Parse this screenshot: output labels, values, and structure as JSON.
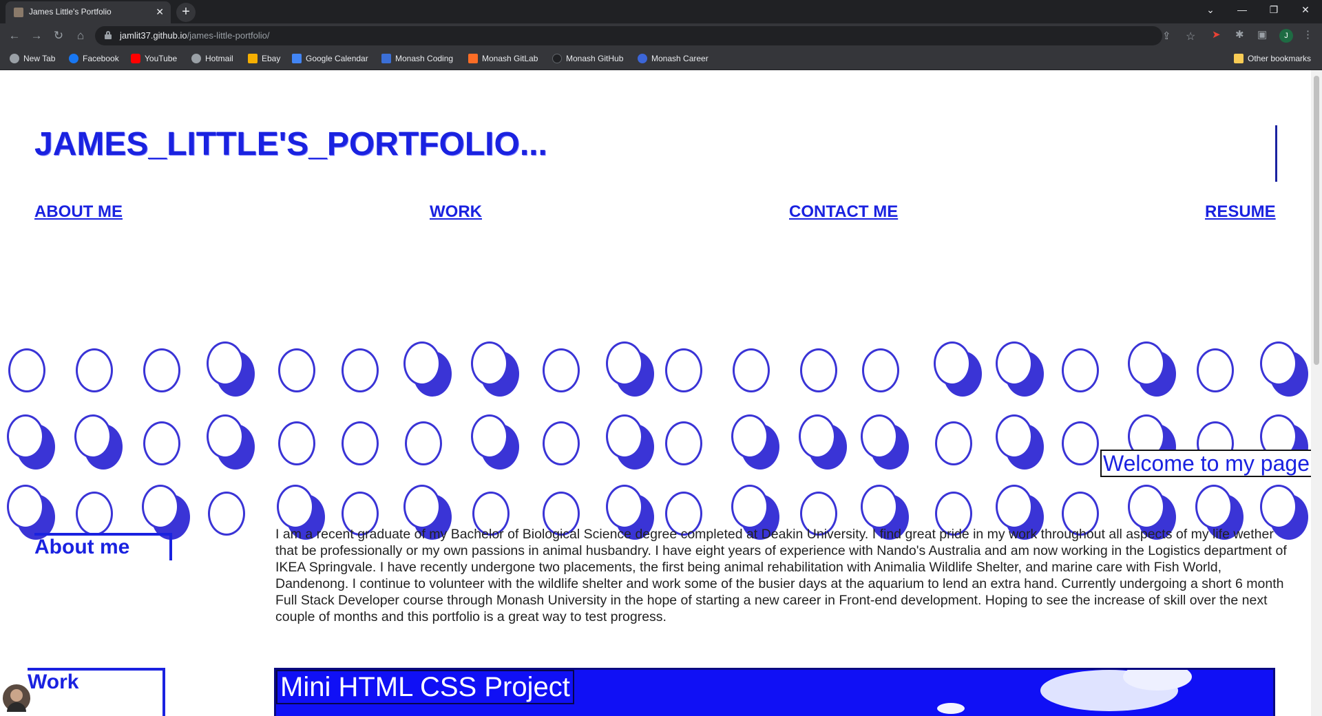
{
  "browser": {
    "tab_title": "James Little's Portfolio",
    "url_host": "jamlit37.github.io",
    "url_path": "/james-little-portfolio/",
    "profile_initial": "J",
    "bookmarks": [
      {
        "label": "New Tab",
        "icon": "globe-icon",
        "color": "#9aa0a6"
      },
      {
        "label": "Facebook",
        "icon": "facebook-icon",
        "color": "#1877f2"
      },
      {
        "label": "YouTube",
        "icon": "youtube-icon",
        "color": "#ff0000"
      },
      {
        "label": "Hotmail",
        "icon": "globe-icon",
        "color": "#9aa0a6"
      },
      {
        "label": "Ebay",
        "icon": "ebay-icon",
        "color": "#f5af02"
      },
      {
        "label": "Google Calendar",
        "icon": "calendar-icon",
        "color": "#4285f4"
      },
      {
        "label": "Monash Coding",
        "icon": "monash-icon",
        "color": "#3b6fd6"
      },
      {
        "label": "Monash  GitLab",
        "icon": "gitlab-icon",
        "color": "#fc6d26"
      },
      {
        "label": "Monash GitHub",
        "icon": "github-icon",
        "color": "#202124"
      },
      {
        "label": "Monash Career",
        "icon": "career-icon",
        "color": "#3c66d8"
      }
    ],
    "other_bookmarks": "Other bookmarks"
  },
  "site": {
    "title": "JAMES_LITTLE'S_PORTFOLIO...",
    "nav": [
      "ABOUT ME",
      "WORK",
      "CONTACT ME",
      "RESUME"
    ],
    "welcome": "Welcome to my page",
    "about_heading": "About me",
    "about_text": "I am a recent graduate of my Bachelor of Biological Science degree completed at Deakin University. I find great pride in my work throughout all aspects of my life wether that be professionally or my own passions in animal husbandry. I have eight years of experience with Nando's Australia and am now working in the Logistics department of IKEA Springvale. I have recently undergone two placements, the first being animal rehabilitation with Animalia Wildlife Shelter, and marine care with Fish World, Dandenong. I continue to volunteer with the wildlife shelter and work some of the busier days at the aquarium to lend an extra hand. Currently undergoing a short 6 month Full Stack Developer course through Monash University in the hope of starting a new career in Front-end development. Hoping to see the increase of skill over the next couple of months and this portfolio is a great way to test progress.",
    "work_heading": "Work",
    "project_title": "Mini HTML CSS Project",
    "accent_color": "#1a22e0"
  }
}
